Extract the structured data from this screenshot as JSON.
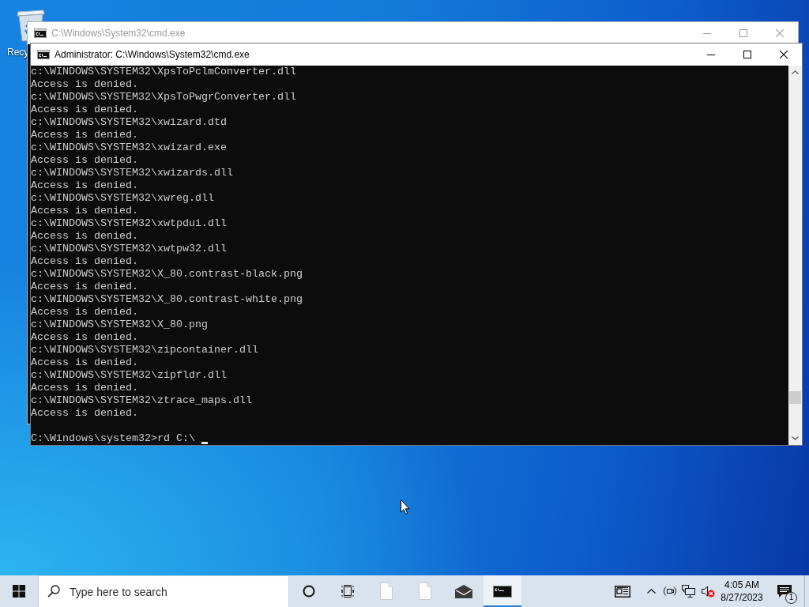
{
  "desktop": {
    "icons": [
      {
        "label": "Recy"
      }
    ]
  },
  "windows": [
    {
      "title": "C:\\Windows\\System32\\cmd.exe",
      "active": false
    },
    {
      "title": "Administrator: C:\\Windows\\System32\\cmd.exe",
      "active": true,
      "output_lines": [
        "c:\\WINDOWS\\SYSTEM32\\XpsToPclmConverter.dll",
        "Access is denied.",
        "c:\\WINDOWS\\SYSTEM32\\XpsToPwgrConverter.dll",
        "Access is denied.",
        "c:\\WINDOWS\\SYSTEM32\\xwizard.dtd",
        "Access is denied.",
        "c:\\WINDOWS\\SYSTEM32\\xwizard.exe",
        "Access is denied.",
        "c:\\WINDOWS\\SYSTEM32\\xwizards.dll",
        "Access is denied.",
        "c:\\WINDOWS\\SYSTEM32\\xwreg.dll",
        "Access is denied.",
        "c:\\WINDOWS\\SYSTEM32\\xwtpdui.dll",
        "Access is denied.",
        "c:\\WINDOWS\\SYSTEM32\\xwtpw32.dll",
        "Access is denied.",
        "c:\\WINDOWS\\SYSTEM32\\X_80.contrast-black.png",
        "Access is denied.",
        "c:\\WINDOWS\\SYSTEM32\\X_80.contrast-white.png",
        "Access is denied.",
        "c:\\WINDOWS\\SYSTEM32\\X_80.png",
        "Access is denied.",
        "c:\\WINDOWS\\SYSTEM32\\zipcontainer.dll",
        "Access is denied.",
        "c:\\WINDOWS\\SYSTEM32\\zipfldr.dll",
        "Access is denied.",
        "c:\\WINDOWS\\SYSTEM32\\ztrace_maps.dll",
        "Access is denied."
      ],
      "prompt_line": "C:\\Windows\\system32>rd C:\\"
    }
  ],
  "taskbar": {
    "search": {
      "placeholder": "Type here to search"
    },
    "apps": [
      {
        "kind": "document",
        "running": false,
        "selected": false
      },
      {
        "kind": "document",
        "running": false,
        "selected": false
      },
      {
        "kind": "mail",
        "running": false,
        "selected": false
      },
      {
        "kind": "console",
        "running": true,
        "selected": true
      }
    ],
    "tray": {
      "volume": {
        "muted": true
      },
      "clock": {
        "time": "4:05 AM",
        "date": "8/27/2023"
      },
      "notifications": {
        "count": "1"
      }
    }
  }
}
